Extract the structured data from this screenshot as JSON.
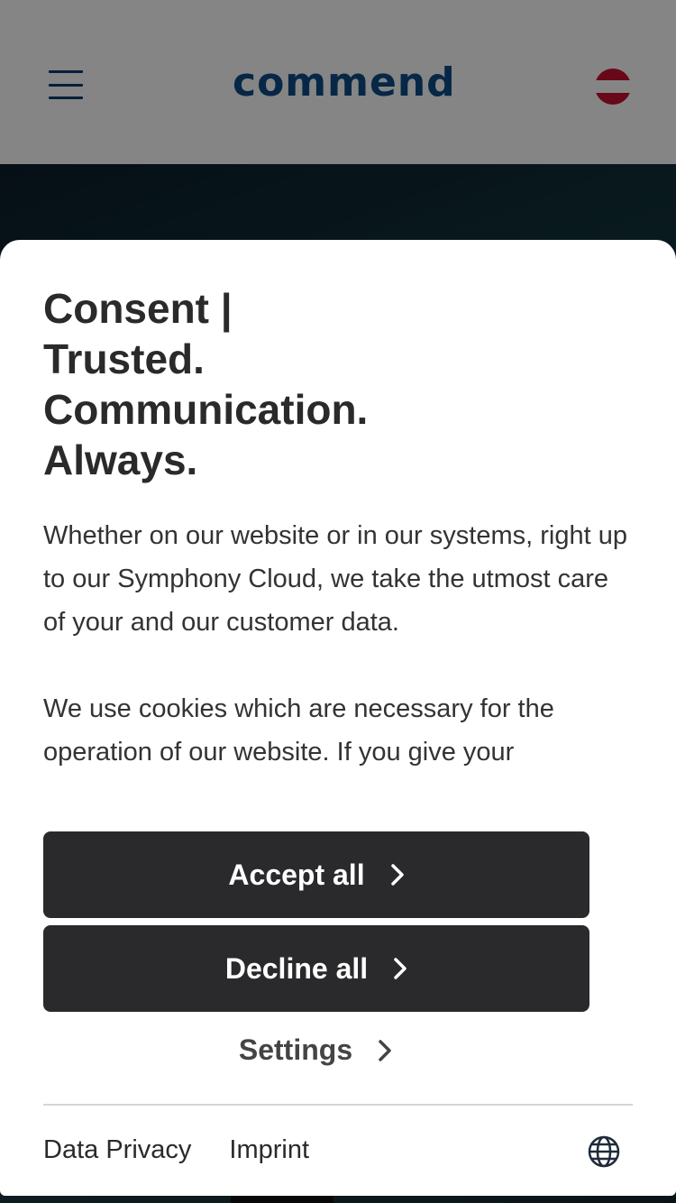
{
  "header": {
    "logo_text": "commend",
    "menu_icon": "hamburger-menu-icon",
    "language_flag": "austria-flag-icon",
    "brand_color": "#0e4c86"
  },
  "consent": {
    "title_lines": [
      "Consent |",
      "Trusted.",
      "Communication.",
      "Always."
    ],
    "paragraph_1": "Whether on our website or in our systems, right up to our Symphony Cloud, we take the utmost care of your and our customer data.",
    "paragraph_2": "We use cookies which are necessary for the operation of our website. If you give your",
    "accept_label": "Accept all",
    "decline_label": "Decline all",
    "settings_label": "Settings",
    "chevron_icon": "chevron-right-icon"
  },
  "footer": {
    "data_privacy_label": "Data Privacy",
    "imprint_label": "Imprint",
    "language_icon": "globe-icon"
  }
}
